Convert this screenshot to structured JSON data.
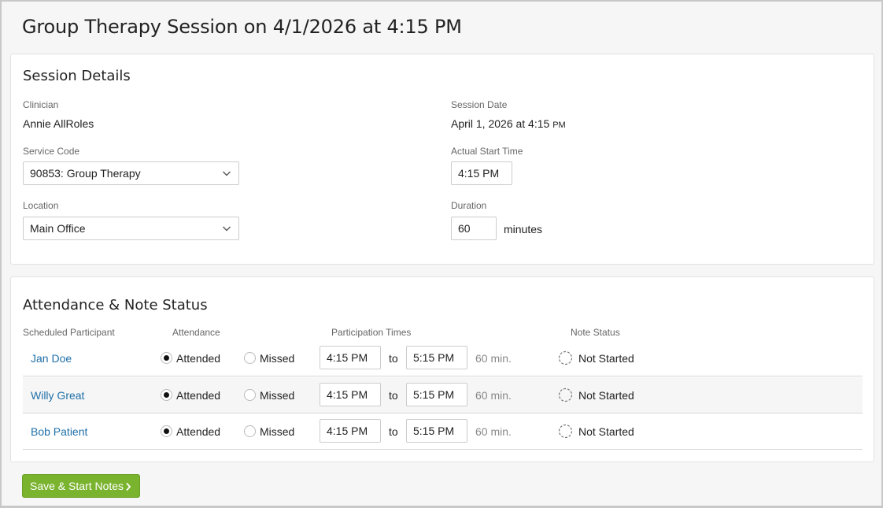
{
  "page": {
    "title": "Group Therapy Session on 4/1/2026 at 4:15 PM"
  },
  "details": {
    "title": "Session Details",
    "clinician_label": "Clinician",
    "clinician_value": "Annie AllRoles",
    "session_date_label": "Session Date",
    "session_date_value": "April 1, 2026 at 4:15",
    "session_date_meridiem": "PM",
    "service_code_label": "Service Code",
    "service_code_value": "90853: Group Therapy",
    "actual_start_label": "Actual Start Time",
    "actual_start_value": "4:15 PM",
    "location_label": "Location",
    "location_value": "Main Office",
    "duration_label": "Duration",
    "duration_value": "60",
    "duration_unit": "minutes"
  },
  "attendance": {
    "title": "Attendance & Note Status",
    "columns": {
      "participant": "Scheduled Participant",
      "attendance": "Attendance",
      "times": "Participation Times",
      "note_status": "Note Status"
    },
    "attended_label": "Attended",
    "missed_label": "Missed",
    "to_label": "to",
    "rows": [
      {
        "name": "Jan Doe",
        "attendance": "Attended",
        "start": "4:15 PM",
        "end": "5:15 PM",
        "minutes": "60 min.",
        "status": "Not Started"
      },
      {
        "name": "Willy Great",
        "attendance": "Attended",
        "start": "4:15 PM",
        "end": "5:15 PM",
        "minutes": "60 min.",
        "status": "Not Started"
      },
      {
        "name": "Bob Patient",
        "attendance": "Attended",
        "start": "4:15 PM",
        "end": "5:15 PM",
        "minutes": "60 min.",
        "status": "Not Started"
      }
    ]
  },
  "actions": {
    "save_label": "Save & Start Notes"
  },
  "colors": {
    "link": "#1f6fa8",
    "primary_button": "#7ab32e"
  },
  "icons": {
    "select_chevron": "chevron-down-icon",
    "button_chevron": "chevron-right-icon",
    "note_status": "dashed-circle-icon"
  }
}
